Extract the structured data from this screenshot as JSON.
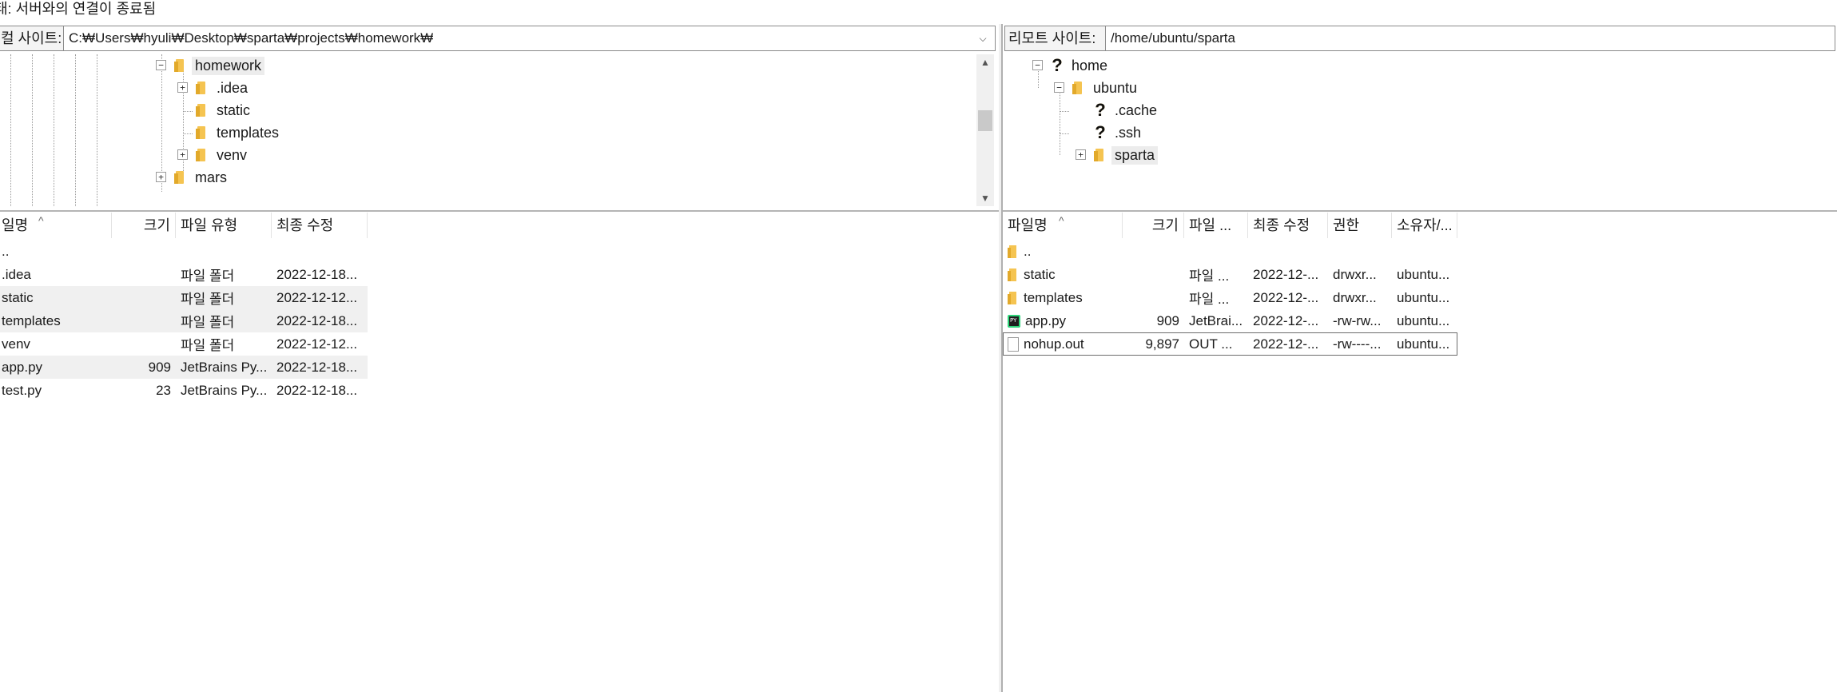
{
  "status": {
    "text": "태: 서버와의 연결이 종료됨"
  },
  "local": {
    "label": "컬 사이트:",
    "path": "C:₩Users₩hyuli₩Desktop₩sparta₩projects₩homework₩",
    "tree": [
      {
        "label": "homework",
        "selected": true
      },
      {
        "label": ".idea"
      },
      {
        "label": "static"
      },
      {
        "label": "templates"
      },
      {
        "label": "venv"
      },
      {
        "label": "mars"
      }
    ],
    "columns": [
      "일명",
      "크기",
      "파일 유형",
      "최종 수정"
    ],
    "files": [
      {
        "name": "..",
        "size": "",
        "type": "",
        "modified": ""
      },
      {
        "name": ".idea",
        "size": "",
        "type": "파일 폴더",
        "modified": "2022-12-18..."
      },
      {
        "name": "static",
        "size": "",
        "type": "파일 폴더",
        "modified": "2022-12-12..."
      },
      {
        "name": "templates",
        "size": "",
        "type": "파일 폴더",
        "modified": "2022-12-18..."
      },
      {
        "name": "venv",
        "size": "",
        "type": "파일 폴더",
        "modified": "2022-12-12..."
      },
      {
        "name": "app.py",
        "size": "909",
        "type": "JetBrains Py...",
        "modified": "2022-12-18..."
      },
      {
        "name": "test.py",
        "size": "23",
        "type": "JetBrains Py...",
        "modified": "2022-12-18..."
      }
    ]
  },
  "remote": {
    "label": "리모트 사이트:",
    "path": "/home/ubuntu/sparta",
    "tree": [
      {
        "label": "home"
      },
      {
        "label": "ubuntu"
      },
      {
        "label": ".cache"
      },
      {
        "label": ".ssh"
      },
      {
        "label": "sparta",
        "selected": true
      }
    ],
    "columns": [
      "파일명",
      "크기",
      "파일 ...",
      "최종 수정",
      "권한",
      "소유자/..."
    ],
    "files": [
      {
        "name": "..",
        "size": "",
        "type": "",
        "modified": "",
        "perm": "",
        "owner": ""
      },
      {
        "name": "static",
        "size": "",
        "type": "파일 ...",
        "modified": "2022-12-...",
        "perm": "drwxr...",
        "owner": "ubuntu..."
      },
      {
        "name": "templates",
        "size": "",
        "type": "파일 ...",
        "modified": "2022-12-...",
        "perm": "drwxr...",
        "owner": "ubuntu..."
      },
      {
        "name": "app.py",
        "size": "909",
        "type": "JetBrai...",
        "modified": "2022-12-...",
        "perm": "-rw-rw...",
        "owner": "ubuntu..."
      },
      {
        "name": "nohup.out",
        "size": "9,897",
        "type": "OUT ...",
        "modified": "2022-12-...",
        "perm": "-rw----...",
        "owner": "ubuntu..."
      }
    ]
  },
  "icons": {
    "folder": "folder-icon",
    "unknown": "question-mark-icon",
    "python": "pycharm-file-icon",
    "file": "file-icon",
    "expand": "expand-plus-icon",
    "collapse": "collapse-minus-icon"
  }
}
